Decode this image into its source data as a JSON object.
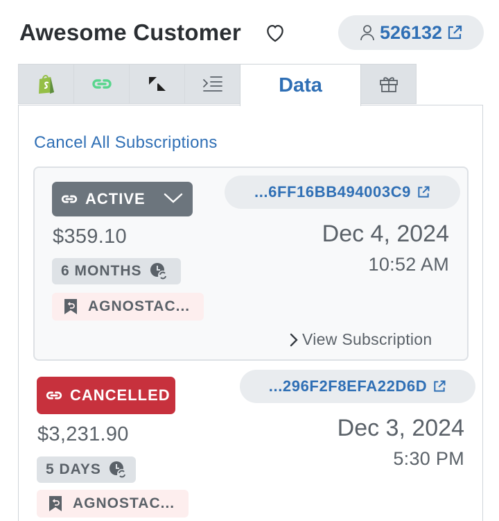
{
  "customer": {
    "name": "Awesome Customer",
    "id": "526132"
  },
  "tabs": [
    {
      "name": "shopify",
      "icon": "shopify-icon",
      "color": "#95bf47"
    },
    {
      "name": "recharge",
      "icon": "link-icon",
      "color": "#58d68d"
    },
    {
      "name": "zendesk",
      "icon": "zendesk-icon",
      "color": "#1f1f1f"
    },
    {
      "name": "outline",
      "icon": "indent-icon",
      "color": "#5a6168"
    },
    {
      "name": "data",
      "label": "Data",
      "active": true
    },
    {
      "name": "gift",
      "icon": "gift-icon",
      "color": "#5a6168"
    }
  ],
  "actions": {
    "cancel_all": "Cancel All Subscriptions"
  },
  "subscriptions": [
    {
      "status": "ACTIVE",
      "status_color": "#6c757d",
      "sub_id": "...6FF16BB494003C9",
      "price": "$359.10",
      "date": "Dec 4, 2024",
      "time": "10:52 AM",
      "period": "6 MONTHS",
      "product": "AGNOSTAC...",
      "view_label": "View Subscription"
    },
    {
      "status": "CANCELLED",
      "status_color": "#c7313d",
      "sub_id": "...296F2F8EFA22D6D",
      "price": "$3,231.90",
      "date": "Dec 3, 2024",
      "time": "5:30 PM",
      "period": "5 DAYS",
      "product": "AGNOSTAC..."
    }
  ]
}
